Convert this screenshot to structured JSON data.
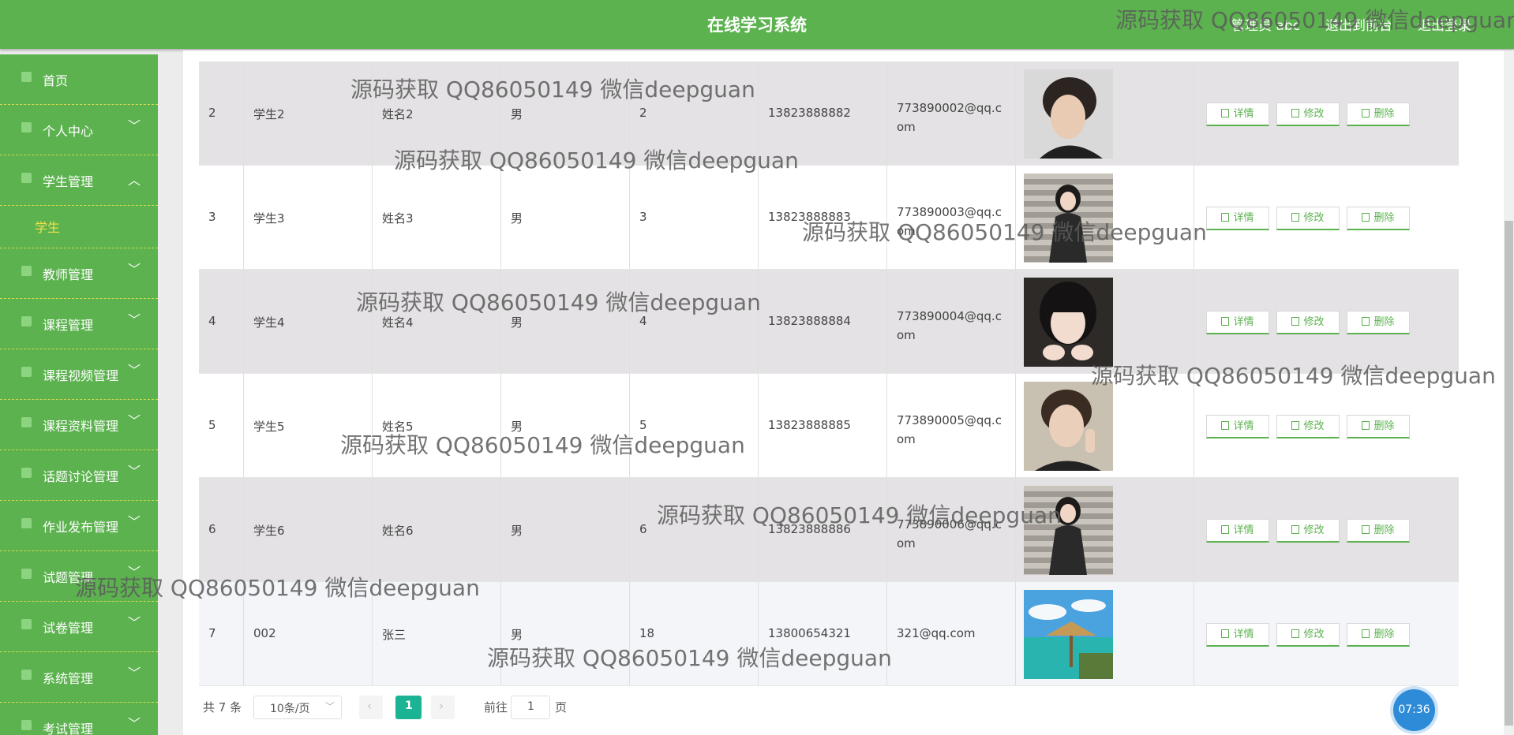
{
  "header": {
    "title": "在线学习系统",
    "admin_label": "管理员 abc",
    "front_link": "退出到前台",
    "logout_link": "退出登录"
  },
  "sidebar": {
    "items": [
      {
        "label": "首页",
        "has_chevron": false
      },
      {
        "label": "个人中心",
        "has_chevron": true
      },
      {
        "label": "学生管理",
        "has_chevron": true,
        "expanded": true
      },
      {
        "label": "教师管理",
        "has_chevron": true
      },
      {
        "label": "课程管理",
        "has_chevron": true
      },
      {
        "label": "课程视频管理",
        "has_chevron": true
      },
      {
        "label": "课程资料管理",
        "has_chevron": true
      },
      {
        "label": "话题讨论管理",
        "has_chevron": true
      },
      {
        "label": "作业发布管理",
        "has_chevron": true
      },
      {
        "label": "试题管理",
        "has_chevron": true
      },
      {
        "label": "试卷管理",
        "has_chevron": true
      },
      {
        "label": "系统管理",
        "has_chevron": true
      },
      {
        "label": "考试管理",
        "has_chevron": true
      }
    ],
    "sub_item": "学生"
  },
  "table": {
    "rows": [
      {
        "index": "2",
        "account": "学生2",
        "name": "姓名2",
        "gender": "男",
        "age": "2",
        "phone": "13823888882",
        "email": "773890002@qq.com",
        "photo": "young man portrait"
      },
      {
        "index": "3",
        "account": "学生3",
        "name": "姓名3",
        "gender": "男",
        "age": "3",
        "phone": "13823888883",
        "email": "773890003@qq.com",
        "photo": "girl on stairs"
      },
      {
        "index": "4",
        "account": "学生4",
        "name": "姓名4",
        "gender": "男",
        "age": "4",
        "phone": "13823888884",
        "email": "773890004@qq.com",
        "photo": "girl with bangs"
      },
      {
        "index": "5",
        "account": "学生5",
        "name": "姓名5",
        "gender": "男",
        "age": "5",
        "phone": "13823888885",
        "email": "773890005@qq.com",
        "photo": "young man peace sign"
      },
      {
        "index": "6",
        "account": "学生6",
        "name": "姓名6",
        "gender": "男",
        "age": "6",
        "phone": "13823888886",
        "email": "773890006@qq.com",
        "photo": "girl on stairs"
      },
      {
        "index": "7",
        "account": "002",
        "name": "张三",
        "gender": "男",
        "age": "18",
        "phone": "13800654321",
        "email": "321@qq.com",
        "photo": "tropical island landscape"
      }
    ],
    "actions": {
      "detail": "详情",
      "edit": "修改",
      "delete": "删除"
    }
  },
  "pagination": {
    "total": "共 7 条",
    "page_size": "10条/页",
    "current_page": "1",
    "goto_label": "前往",
    "goto_value": "1",
    "page_unit": "页"
  },
  "clock": "07:36",
  "watermark": "源码获取 QQ86050149 微信deepguan",
  "colors": {
    "brand_green": "#5cb24f",
    "active_page": "#1ab394",
    "submenu_active": "#f3e14a"
  }
}
